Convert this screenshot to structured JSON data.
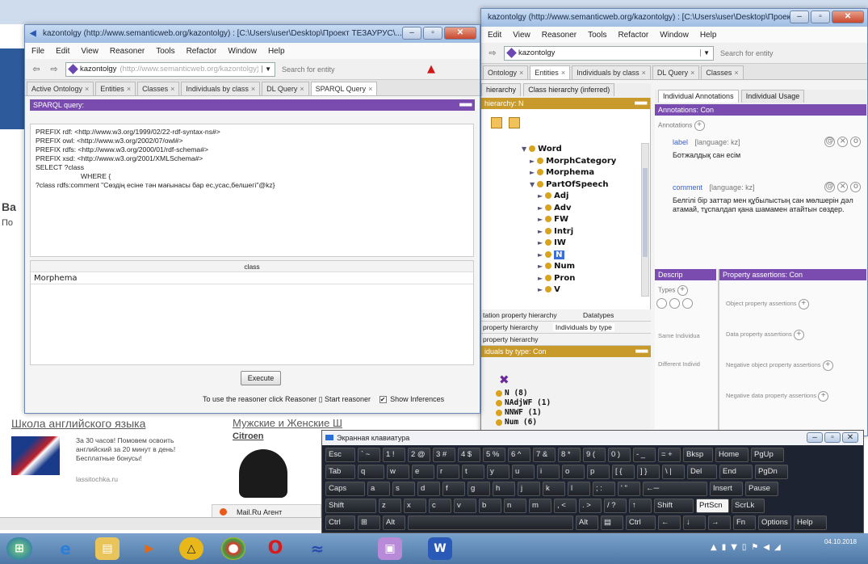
{
  "sparql_window": {
    "title": "kazontolgy (http://www.semanticweb.org/kazontolgy) : [C:\\Users\\user\\Desktop\\Проект ТЕЗАУРУС\\...",
    "menu": [
      "File",
      "Edit",
      "View",
      "Reasoner",
      "Tools",
      "Refactor",
      "Window",
      "Help"
    ],
    "ontology_combo": "kazontolgy",
    "ontology_iri": "(http://www.semanticweb.org/kazontolgy)",
    "search_placeholder": "Search for entity",
    "tabs": [
      "Active Ontology",
      "Entities",
      "Classes",
      "Individuals by class",
      "DL Query",
      "SPARQL Query"
    ],
    "query_header": "SPARQL query:",
    "query_lines": [
      "PREFIX rdf: <http://www.w3.org/1999/02/22-rdf-syntax-ns#>",
      "PREFIX owl: <http://www.w3.org/2002/07/owl#>",
      "PREFIX rdfs: <http://www.w3.org/2000/01/rdf-schema#>",
      "PREFIX xsd: <http://www.w3.org/2001/XMLSchema#>",
      "SELECT ?class",
      "WHERE {",
      "?class rdfs:comment \"Сөздің есіне тән мағынасы бар ес,усас,белшегі\"@kz}"
    ],
    "result_column": "class",
    "result_value": "Morphema",
    "execute_label": "Execute",
    "status_text": "To use the reasoner click Reasoner ▯ Start reasoner",
    "show_inferences": "Show Inferences"
  },
  "main_window": {
    "title": "kazontolgy (http://www.semanticweb.org/kazontolgy) : [C:\\Users\\user\\Desktop\\Проект...",
    "menu": [
      "Edit",
      "View",
      "Reasoner",
      "Tools",
      "Refactor",
      "Window",
      "Help"
    ],
    "ontology_combo": "kazontolgy",
    "search_placeholder": "Search for entity",
    "tabs": [
      "Ontology",
      "Entities",
      "Individuals by class",
      "DL Query",
      "Classes"
    ],
    "hierarchy_tabs": [
      "hierarchy",
      "Class hierarchy (inferred)"
    ],
    "hierarchy_header": "hierarchy: N",
    "tree": [
      {
        "label": "Word",
        "arrow": "▼"
      },
      {
        "label": "MorphCategory",
        "arrow": "►"
      },
      {
        "label": "Morphema",
        "arrow": "►"
      },
      {
        "label": "PartOfSpeech",
        "arrow": "▼"
      },
      {
        "label": "Adj",
        "arrow": "►"
      },
      {
        "label": "Adv",
        "arrow": "►"
      },
      {
        "label": "FW",
        "arrow": "►"
      },
      {
        "label": "Intrj",
        "arrow": "►"
      },
      {
        "label": "IW",
        "arrow": "►"
      },
      {
        "label": "N",
        "arrow": "►"
      },
      {
        "label": "Num",
        "arrow": "►"
      },
      {
        "label": "Pron",
        "arrow": "►"
      },
      {
        "label": "V",
        "arrow": "►"
      }
    ],
    "lower_tabs": [
      "tation property hierarchy",
      "Datatypes"
    ],
    "lower_tabs2": [
      "property hierarchy",
      "Individuals by type"
    ],
    "lower_tab3": "property hierarchy",
    "individuals_header": "iduals by type: Con",
    "individuals": [
      "N (8)",
      "NAdjWF (1)",
      "NNWF (1)",
      "Num (6)"
    ],
    "right_tabs": [
      "Individual Annotations",
      "Individual Usage"
    ],
    "annotations_header": "Annotations: Con",
    "annotations_label": "Annotations",
    "label_annotation": {
      "name": "label",
      "lang": "[language: kz]",
      "text": "Ботжалдық сан есім"
    },
    "comment_annotation": {
      "name": "comment",
      "lang": "[language: kz]",
      "text": "Белгілі бір заттар мен құбылыстың сан мөлшерін дәл атамай, тұспалдап қана шамамен атайтын сөздер."
    },
    "descrip_header": "Descrip",
    "types_label": "Types",
    "same_ind": "Same Individua",
    "diff_ind": "Different Individ",
    "prop_header": "Property assertions: Con",
    "obj_prop": "Object property assertions",
    "data_prop": "Data property assertions",
    "neg_obj_prop": "Negative object property assertions",
    "neg_data_prop": "Negative data property assertions"
  },
  "browser": {
    "ad1_title": "Школа английского языка",
    "ad1_text": "За 30 часов! Помовем освоить английский за 20 минут в день! Бесплатные бонусы!",
    "ad1_link": "lassitochka.ru",
    "ad2_title": "Мужские и Женские Ш",
    "ad2_text": "Citroen",
    "mailru": "Mail.Ru Агент",
    "side_text": "Ва",
    "side_text2": "По"
  },
  "osk": {
    "title": "Экранная клавиатура",
    "rows": [
      [
        "Esc",
        "` ~",
        "1 !",
        "2 @",
        "3 #",
        "4 $",
        "5 %",
        "6 ^",
        "7 &",
        "8 *",
        "9 (",
        "0 )",
        "- _",
        "= +",
        "Bksp",
        "Home",
        "PgUp"
      ],
      [
        "Tab",
        "q",
        "w",
        "e",
        "r",
        "t",
        "y",
        "u",
        "i",
        "o",
        "p",
        "[ {",
        "] }",
        "\\ |",
        "Del",
        "End",
        "PgDn"
      ],
      [
        "Caps",
        "a",
        "s",
        "d",
        "f",
        "g",
        "h",
        "j",
        "k",
        "l",
        "; :",
        "' \"",
        "←─",
        "Insert",
        "Pause"
      ],
      [
        "Shift",
        "z",
        "x",
        "c",
        "v",
        "b",
        "n",
        "m",
        ", <",
        ". >",
        "/ ?",
        "↑",
        "Shift",
        "PrtScn",
        "ScrLk"
      ],
      [
        "Ctrl",
        "⊞",
        "Alt",
        "",
        "Alt",
        "▤",
        "Ctrl",
        "←",
        "↓",
        "→",
        "Fn",
        "Options",
        "Help"
      ]
    ]
  },
  "taskbar": {
    "clock_time": "",
    "clock_date": "04.10.2018"
  }
}
